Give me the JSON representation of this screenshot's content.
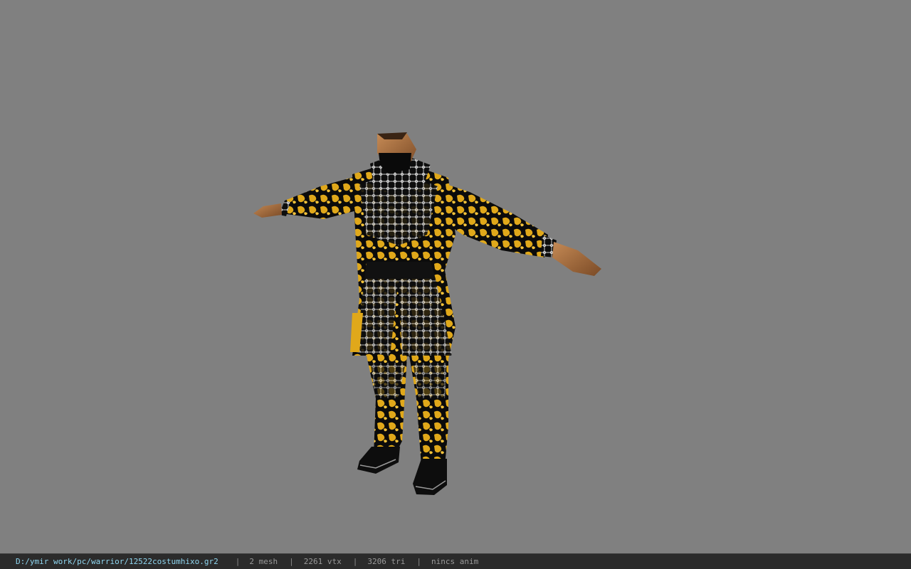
{
  "viewer": {
    "background_color": "#808080",
    "model_name_icon": "character-model"
  },
  "status_bar": {
    "path": "D:/ymir work/pc/warrior/12522costumhixo.gr2",
    "mesh": "2 mesh",
    "vertices": "2261 vtx",
    "triangles": "3206 tri",
    "animation": "nincs anim",
    "separator": "|"
  }
}
